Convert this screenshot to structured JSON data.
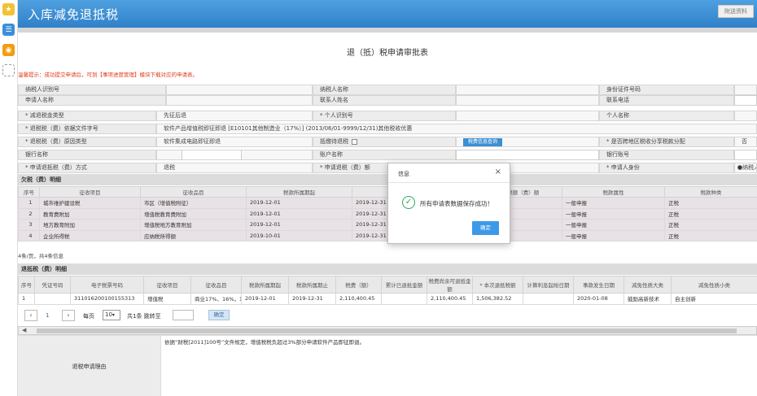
{
  "app": {
    "title": "入库减免退抵税",
    "help_button": "附送资料",
    "form_title": "退（抵）税申请审批表",
    "tip": "温馨提示：成功提交申请后，可到【事项进度管理】模块下载对应的申请表。"
  },
  "info": {
    "taxpayer_id_label": "纳税人识别号",
    "taxpayer_name_label": "纳税人名称",
    "id_no_label": "身份证件号码",
    "applicant_name_label": "申请人名称",
    "contact_name_label": "联系人姓名",
    "contact_phone_label": "联系电话",
    "refund_type_label": "* 减退税金类型",
    "refund_type_value": "先征后退",
    "personal_id_label": "* 个人识别号",
    "personal_name_label": "个人名称",
    "basis_label": "* 退税税（费）依据文件字号",
    "basis_value": "软件产品增值税即征即退 [E10101其他制造业（17%）] (2013/06/01-9999/12/31)其他税收优惠",
    "reason_label": "* 退税税（费）原因类型",
    "reason_value": "软件集成电路即征即退",
    "deduct_label": "抵缴待退税",
    "query_button": "税费信息查询",
    "cross_region_label": "* 是否跨地区税收分享税款分配",
    "cross_region_value": "否",
    "bank_name_label": "银行名称",
    "account_name_label": "账户名称",
    "bank_account_label": "银行账号",
    "method_label": "* 申请退抵税（费）方式",
    "method_value": "退税",
    "amount_label": "* 申请退税（费）额",
    "identity_label": "* 申请人身份",
    "identity_value": "纳税人"
  },
  "owed": {
    "title": "欠税（费）明细",
    "headers": [
      "序号",
      "征收项目",
      "征收品目",
      "税款所属期起",
      "税款所属期止",
      "应补（退）税额（费）额",
      "税款属性",
      "税款种类"
    ],
    "rows": [
      [
        "1",
        "城市维护建设税",
        "市区（增值税附征）",
        "2019-12-01",
        "2019-12-31",
        "",
        "一般申报",
        "正税"
      ],
      [
        "2",
        "教育费附加",
        "增值税教育费附加",
        "2019-12-01",
        "2019-12-31",
        "",
        "一般申报",
        "正税"
      ],
      [
        "3",
        "地方教育附加",
        "增值税地方教育附加",
        "2019-12-01",
        "2019-12-31",
        "",
        "一般申报",
        "正税"
      ],
      [
        "4",
        "企业所得税",
        "应纳税所得额",
        "2019-10-01",
        "2019-12-31",
        "-583552.04",
        "一般申报",
        "正税"
      ]
    ],
    "count": "4条/页，共4条信息"
  },
  "refund": {
    "title": "退抵税（费）明细",
    "headers": [
      "序号",
      "凭证号码",
      "电子税票号码",
      "征收项目",
      "征收品目",
      "税款所属期起",
      "税款所属期止",
      "税费（额）",
      "累计已退抵金额",
      "税费尚余可退抵金额",
      "* 本次退抵税额",
      "计算利息起始日期",
      "事款发生日期",
      "减免性质大类",
      "减免性质小类"
    ],
    "rows": [
      [
        "1",
        "",
        "311016200100155313",
        "增值税",
        "商业17%、16%，13%",
        "2019-12-01",
        "2019-12-31",
        "2,110,400.45",
        "",
        "2,110,400.45",
        "1,506,382.52",
        "",
        "2020-01-08",
        "鼓励高新技术",
        "自主创新"
      ]
    ]
  },
  "pager": {
    "page": "1",
    "per_page_label": "每页",
    "per_page_value": "10",
    "total": "共1条 跳转至",
    "confirm": "确定"
  },
  "reason_section": {
    "label": "退税申请理由",
    "text": "依据“财税[2011]100号”文件规定，增值税税负超过3%部分申请软件产品即征即退。"
  },
  "modal": {
    "title": "信息",
    "close": "×",
    "message": "所有申请表数据保存成功！",
    "ok": "确定"
  }
}
